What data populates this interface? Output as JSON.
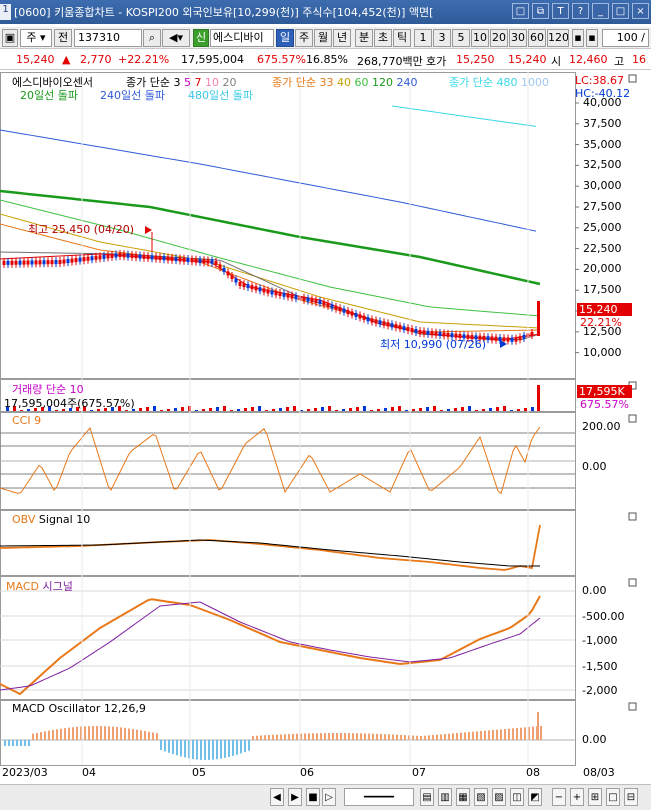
{
  "title": {
    "window_number": "1",
    "text": "[0600] 키움종합차트 - KOSPI200 외국인보유[10,299(천)] 주식수[104,452(천)] 액면[",
    "buttons": [
      "□",
      "⧉",
      "T",
      "?",
      "_",
      "□",
      "×"
    ]
  },
  "toolbar": {
    "market_type": "주",
    "prev": "전",
    "code": "137310",
    "new_badge": "신",
    "stock_name": "에스디바이",
    "periods": [
      "일",
      "주",
      "월",
      "년",
      "분",
      "초",
      "틱"
    ],
    "active_period": "일",
    "intervals": [
      "1",
      "3",
      "5",
      "10",
      "20",
      "30",
      "60",
      "120"
    ],
    "count": "100"
  },
  "price_bar": {
    "price": "15,240",
    "change": "2,770",
    "change_pct": "+22.21%",
    "volume": "17,595,004",
    "volume_pct": "675.57%",
    "turnover": "16.85%",
    "amount": "268,770백만",
    "hoga_label": "호가",
    "hoga": "15,250",
    "current": "15,240",
    "open_label": "시",
    "open": "12,460",
    "high_label": "고",
    "high": "16"
  },
  "main_panel": {
    "name": "에스디바이오센서",
    "ma_label": "종가 단순",
    "ma_periods": [
      "3",
      "5",
      "7",
      "10",
      "20"
    ],
    "ma2_label": "종가 단순",
    "ma2_periods": [
      "33",
      "40",
      "60",
      "120",
      "240"
    ],
    "ma3_label": "종가 단순",
    "ma3_periods": [
      "480",
      "1000"
    ],
    "lc": "LC:38.67",
    "hc": "HC:-40.12",
    "break_labels": [
      "20일선 돌파",
      "240일선 돌파",
      "480일선 돌파"
    ],
    "high_annot": "최고 25,450 (04/20)",
    "low_annot": "최저 10,990 (07/26)",
    "price_tag": "15,240",
    "pct_tag": "22.21%",
    "y_ticks": [
      "40,000",
      "37,500",
      "35,000",
      "32,500",
      "30,000",
      "27,500",
      "25,000",
      "22,500",
      "20,000",
      "17,500",
      "15,000",
      "12,500",
      "10,000"
    ]
  },
  "volume_panel": {
    "title": "거래량 단순 10",
    "info": "17,595,004주(675.57%)",
    "tag": "17,595K",
    "tag_pct": "675.57%"
  },
  "cci_panel": {
    "title": "CCI 9",
    "y_ticks": [
      "200.00",
      "0.00"
    ]
  },
  "obv_panel": {
    "title": "OBV",
    "signal": "Signal 10"
  },
  "macd_panel": {
    "title": "MACD",
    "signal": "시그널",
    "y_ticks": [
      "0.00",
      "-500.00",
      "-1,000",
      "-1,500",
      "-2,000"
    ]
  },
  "osc_panel": {
    "title": "MACD Oscillator 12,26,9",
    "y_ticks": [
      "0.00"
    ]
  },
  "x_axis": [
    "2023/03",
    "04",
    "05",
    "06",
    "07",
    "08",
    "08/03"
  ],
  "colors": {
    "up": "#e30000",
    "down": "#0039d6",
    "ma120": "#1a9a1a",
    "ma240": "#2f5ad8",
    "ma480": "#38d8e8",
    "orange": "#e87818"
  }
}
